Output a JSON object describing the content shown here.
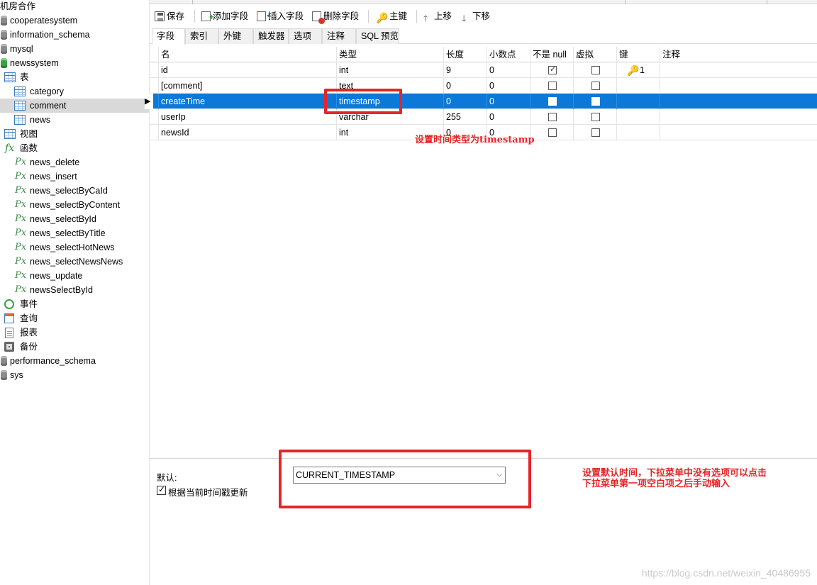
{
  "sidebar": {
    "items": [
      {
        "label": "机房合作",
        "icon": "",
        "indent": 0
      },
      {
        "label": "cooperatesystem",
        "icon": "db",
        "indent": 0
      },
      {
        "label": "information_schema",
        "icon": "db",
        "indent": 0
      },
      {
        "label": "mysql",
        "icon": "db",
        "indent": 0
      },
      {
        "label": "newssystem",
        "icon": "db-green",
        "indent": 0
      },
      {
        "label": "表",
        "icon": "tables",
        "indent": 1
      },
      {
        "label": "category",
        "icon": "table",
        "indent": 2
      },
      {
        "label": "comment",
        "icon": "table",
        "indent": 2
      },
      {
        "label": "news",
        "icon": "table",
        "indent": 2
      },
      {
        "label": "视图",
        "icon": "views",
        "indent": 1
      },
      {
        "label": "函数",
        "icon": "fx",
        "indent": 1
      },
      {
        "label": "news_delete",
        "icon": "px",
        "indent": 2
      },
      {
        "label": "news_insert",
        "icon": "px",
        "indent": 2
      },
      {
        "label": "news_selectByCaId",
        "icon": "px",
        "indent": 2
      },
      {
        "label": "news_selectByContent",
        "icon": "px",
        "indent": 2
      },
      {
        "label": "news_selectById",
        "icon": "px",
        "indent": 2
      },
      {
        "label": "news_selectByTitle",
        "icon": "px",
        "indent": 2
      },
      {
        "label": "news_selectHotNews",
        "icon": "px",
        "indent": 2
      },
      {
        "label": "news_selectNewsNews",
        "icon": "px",
        "indent": 2
      },
      {
        "label": "news_update",
        "icon": "px",
        "indent": 2
      },
      {
        "label": "newsSelectById",
        "icon": "px",
        "indent": 2
      },
      {
        "label": "事件",
        "icon": "clock",
        "indent": 1
      },
      {
        "label": "查询",
        "icon": "query",
        "indent": 1
      },
      {
        "label": "报表",
        "icon": "report",
        "indent": 1
      },
      {
        "label": "备份",
        "icon": "backup",
        "indent": 1
      },
      {
        "label": "performance_schema",
        "icon": "db",
        "indent": 0
      },
      {
        "label": "sys",
        "icon": "db",
        "indent": 0
      }
    ],
    "selected_index": 7
  },
  "toolbar": {
    "save": "保存",
    "add_field": "添加字段",
    "insert_field": "插入字段",
    "delete_field": "删除字段",
    "primary_key": "主键",
    "move_up": "上移",
    "move_down": "下移"
  },
  "tabs": [
    "字段",
    "索引",
    "外键",
    "触发器",
    "选项",
    "注释",
    "SQL 预览"
  ],
  "active_tab": 0,
  "grid": {
    "headers": {
      "name": "名",
      "type": "类型",
      "length": "长度",
      "decimals": "小数点",
      "not_null": "不是 null",
      "virtual": "虚拟",
      "key": "键",
      "comment": "注释"
    },
    "rows": [
      {
        "name": "id",
        "type": "int",
        "length": "9",
        "decimals": "0",
        "not_null": true,
        "virtual": false,
        "key": "1"
      },
      {
        "name": "[comment]",
        "type": "text",
        "length": "0",
        "decimals": "0",
        "not_null": false,
        "virtual": false,
        "key": ""
      },
      {
        "name": "createTime",
        "type": "timestamp",
        "length": "0",
        "decimals": "0",
        "not_null": false,
        "virtual": false,
        "key": ""
      },
      {
        "name": "userIp",
        "type": "varchar",
        "length": "255",
        "decimals": "0",
        "not_null": false,
        "virtual": false,
        "key": ""
      },
      {
        "name": "newsId",
        "type": "int",
        "length": "0",
        "decimals": "0",
        "not_null": false,
        "virtual": false,
        "key": ""
      }
    ],
    "selected_row": 2
  },
  "properties": {
    "default_label": "默认:",
    "default_value": "CURRENT_TIMESTAMP",
    "update_checkbox_label": "根据当前时间戳更新",
    "update_checked": true
  },
  "annotations": {
    "type_note": "设置时间类型为timestamp",
    "default_note_line1": "设置默认时间，下拉菜单中没有选项可以点击",
    "default_note_line2": "下拉菜单第一项空白项之后手动输入",
    "watermark": "https://blog.csdn.net/weixin_40486955"
  },
  "colors": {
    "selection": "#0c78d7",
    "annotation_red": "#e52527",
    "sidebar_selected": "#d9d9d9"
  }
}
